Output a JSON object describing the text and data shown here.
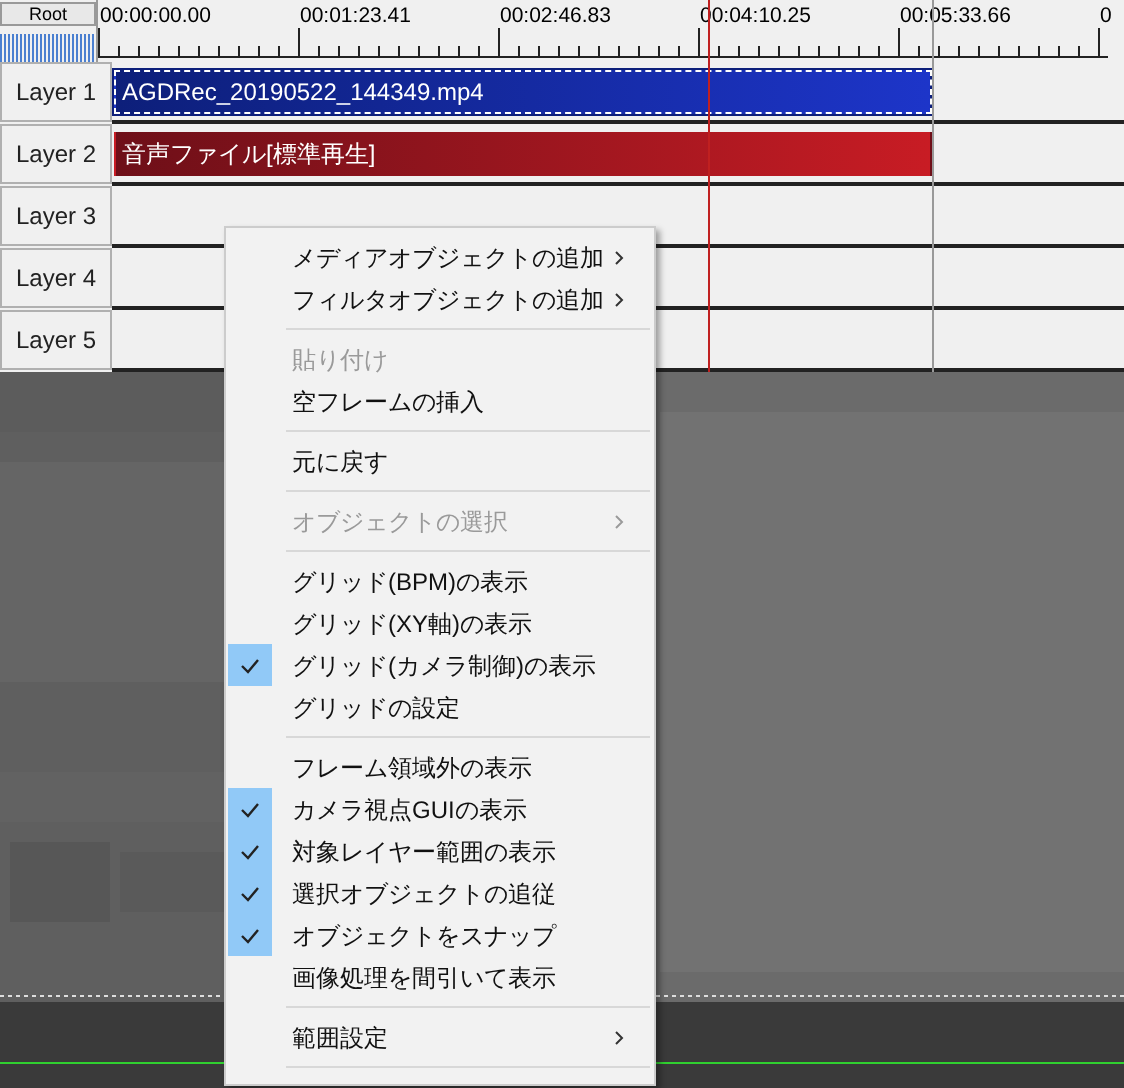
{
  "root_button": "Root",
  "ruler": {
    "ticks": [
      "00:00:00.00",
      "00:01:23.41",
      "00:02:46.83",
      "00:04:10.25",
      "00:05:33.66",
      "0"
    ]
  },
  "layers": [
    {
      "name": "Layer 1",
      "clip": {
        "kind": "video",
        "label": "AGDRec_20190522_144349.mp4",
        "selected": true
      }
    },
    {
      "name": "Layer 2",
      "clip": {
        "kind": "audio",
        "label": "音声ファイル[標準再生]",
        "selected": false
      }
    },
    {
      "name": "Layer 3"
    },
    {
      "name": "Layer 4"
    },
    {
      "name": "Layer 5"
    }
  ],
  "context_menu": [
    {
      "kind": "item",
      "label": "メディアオブジェクトの追加",
      "submenu": true,
      "disabled": false,
      "checked": false
    },
    {
      "kind": "item",
      "label": "フィルタオブジェクトの追加",
      "submenu": true,
      "disabled": false,
      "checked": false
    },
    {
      "kind": "separator"
    },
    {
      "kind": "item",
      "label": "貼り付け",
      "submenu": false,
      "disabled": true,
      "checked": false
    },
    {
      "kind": "item",
      "label": "空フレームの挿入",
      "submenu": false,
      "disabled": false,
      "checked": false
    },
    {
      "kind": "separator"
    },
    {
      "kind": "item",
      "label": "元に戻す",
      "submenu": false,
      "disabled": false,
      "checked": false
    },
    {
      "kind": "separator"
    },
    {
      "kind": "item",
      "label": "オブジェクトの選択",
      "submenu": true,
      "disabled": true,
      "checked": false
    },
    {
      "kind": "separator"
    },
    {
      "kind": "item",
      "label": "グリッド(BPM)の表示",
      "submenu": false,
      "disabled": false,
      "checked": false
    },
    {
      "kind": "item",
      "label": "グリッド(XY軸)の表示",
      "submenu": false,
      "disabled": false,
      "checked": false
    },
    {
      "kind": "item",
      "label": "グリッド(カメラ制御)の表示",
      "submenu": false,
      "disabled": false,
      "checked": true
    },
    {
      "kind": "item",
      "label": "グリッドの設定",
      "submenu": false,
      "disabled": false,
      "checked": false
    },
    {
      "kind": "separator"
    },
    {
      "kind": "item",
      "label": "フレーム領域外の表示",
      "submenu": false,
      "disabled": false,
      "checked": false
    },
    {
      "kind": "item",
      "label": "カメラ視点GUIの表示",
      "submenu": false,
      "disabled": false,
      "checked": true
    },
    {
      "kind": "item",
      "label": "対象レイヤー範囲の表示",
      "submenu": false,
      "disabled": false,
      "checked": true
    },
    {
      "kind": "item",
      "label": "選択オブジェクトの追従",
      "submenu": false,
      "disabled": false,
      "checked": true
    },
    {
      "kind": "item",
      "label": "オブジェクトをスナップ",
      "submenu": false,
      "disabled": false,
      "checked": true
    },
    {
      "kind": "item",
      "label": "画像処理を間引いて表示",
      "submenu": false,
      "disabled": false,
      "checked": false
    },
    {
      "kind": "separator"
    },
    {
      "kind": "item",
      "label": "範囲設定",
      "submenu": true,
      "disabled": false,
      "checked": false
    },
    {
      "kind": "separator"
    }
  ]
}
